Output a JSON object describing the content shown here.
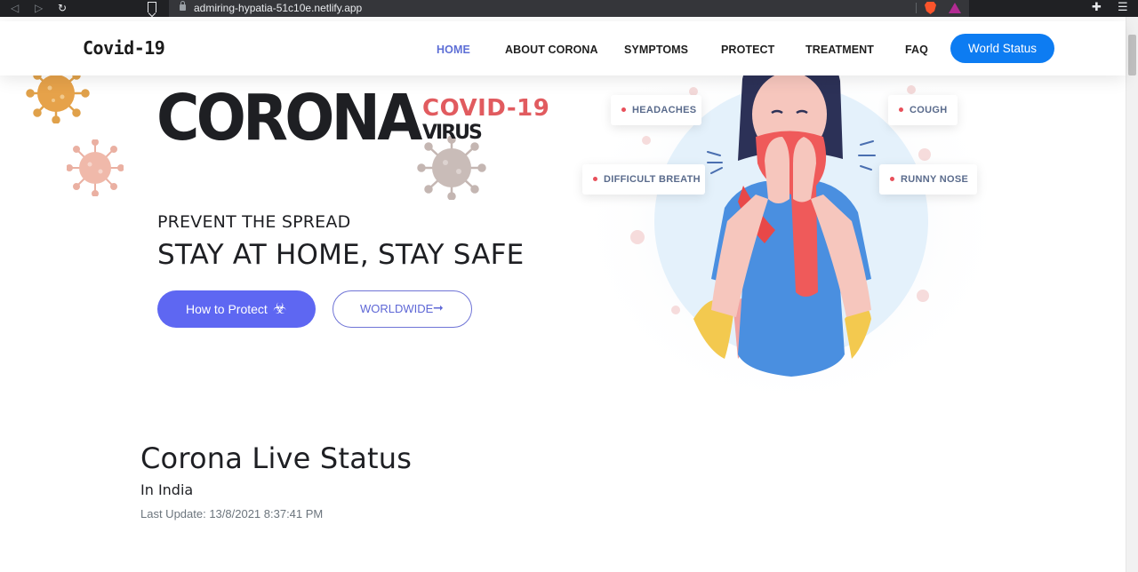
{
  "browser": {
    "url": "admiring-hypatia-51c10e.netlify.app",
    "back_icon": "back-arrow-icon",
    "forward_icon": "forward-arrow-icon",
    "reload_icon": "reload-icon",
    "bookmark_icon": "bookmark-icon",
    "lock_icon": "lock-icon",
    "brave_icon": "brave-shields-icon",
    "rewards_icon": "brave-rewards-icon",
    "extensions_icon": "puzzle-icon",
    "menu_icon": "hamburger-icon"
  },
  "header": {
    "logo": "Covid-19",
    "nav": [
      {
        "label": "HOME",
        "active": true
      },
      {
        "label": "ABOUT CORONA",
        "active": false
      },
      {
        "label": "SYMPTOMS",
        "active": false
      },
      {
        "label": "PROTECT",
        "active": false
      },
      {
        "label": "TREATMENT",
        "active": false
      },
      {
        "label": "FAQ",
        "active": false
      }
    ],
    "cta": "World Status"
  },
  "hero": {
    "title": "CORONA",
    "tag_covid": "COVID-19",
    "tag_virus": "VIRUS",
    "prevent": "PREVENT THE SPREAD",
    "stay": "STAY AT HOME, STAY SAFE",
    "protect_button": "How to Protect",
    "protect_icon": "biohazard-icon",
    "worldwide_button": "WORLDWIDE",
    "worldwide_icon": "arrow-right-icon"
  },
  "symptoms": [
    "HEADACHES",
    "COUGH",
    "DIFFICULT BREATH",
    "RUNNY NOSE"
  ],
  "live_status": {
    "title": "Corona Live Status",
    "region": "In India",
    "last_update": "Last Update: 13/8/2021 8:37:41 PM"
  },
  "colors": {
    "accent": "#5e67f2",
    "cta_blue": "#0d7cf2",
    "covid_red": "#e15b5f",
    "nav_active": "#5e6fd6",
    "symptom_text": "#5a6b8c"
  }
}
